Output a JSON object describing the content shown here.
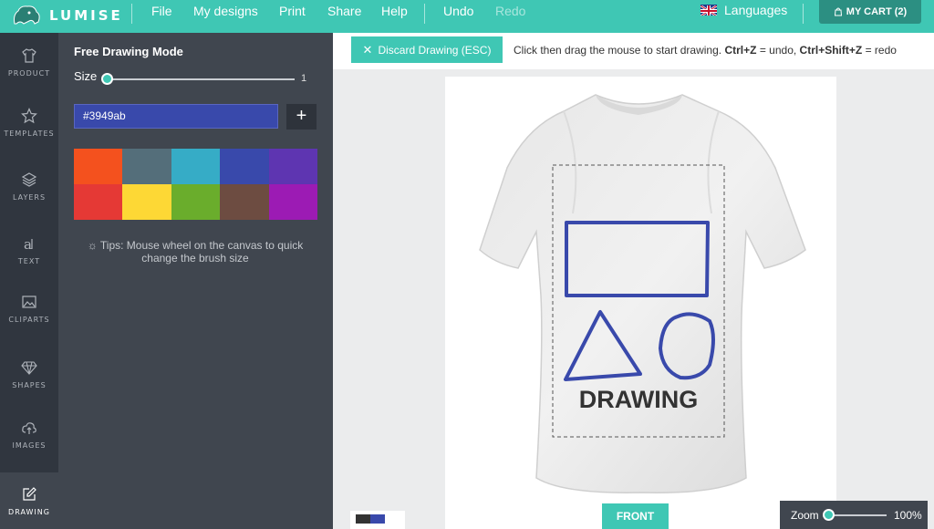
{
  "app": {
    "name": "LUMISE"
  },
  "menu": {
    "file": "File",
    "my_designs": "My designs",
    "print": "Print",
    "share": "Share",
    "help": "Help",
    "undo": "Undo",
    "redo": "Redo",
    "languages": "Languages",
    "cart": "MY CART (2)"
  },
  "nav": {
    "product": "PRODUCT",
    "templates": "TEMPLATES",
    "layers": "LAYERS",
    "text": "TEXT",
    "cliparts": "CLIPARTS",
    "shapes": "SHAPES",
    "images": "IMAGES",
    "drawing": "DRAWING"
  },
  "panel": {
    "title": "Free Drawing Mode",
    "size_label": "Size",
    "size_value": "1",
    "color_value": "#3949ab",
    "add_label": "+",
    "tips": "Tips: Mouse wheel on the canvas to quick change the brush size",
    "palette": [
      "#f4511e",
      "#546e7a",
      "#36acc6",
      "#3949ab",
      "#5e35b1",
      "#e53935",
      "#fdd835",
      "#6aad2c",
      "#6d4c41",
      "#9c1bb4"
    ]
  },
  "toolbar": {
    "discard_label": "Discard Drawing (ESC)",
    "hint_pre": "Click then drag the mouse to start drawing.",
    "hint_k1": "Ctrl+Z",
    "hint_mid": "= undo,",
    "hint_k2": "Ctrl+Shift+Z",
    "hint_post": "= redo"
  },
  "canvas": {
    "drawing_text": "DRAWING",
    "brush_color": "#3949ab",
    "front_label": "FRONT"
  },
  "zoom": {
    "label": "Zoom",
    "value": "100%",
    "level": 0
  },
  "colors": {
    "accent": "#3fc7b4",
    "sidebar": "#30363f",
    "panel": "#40464f"
  }
}
